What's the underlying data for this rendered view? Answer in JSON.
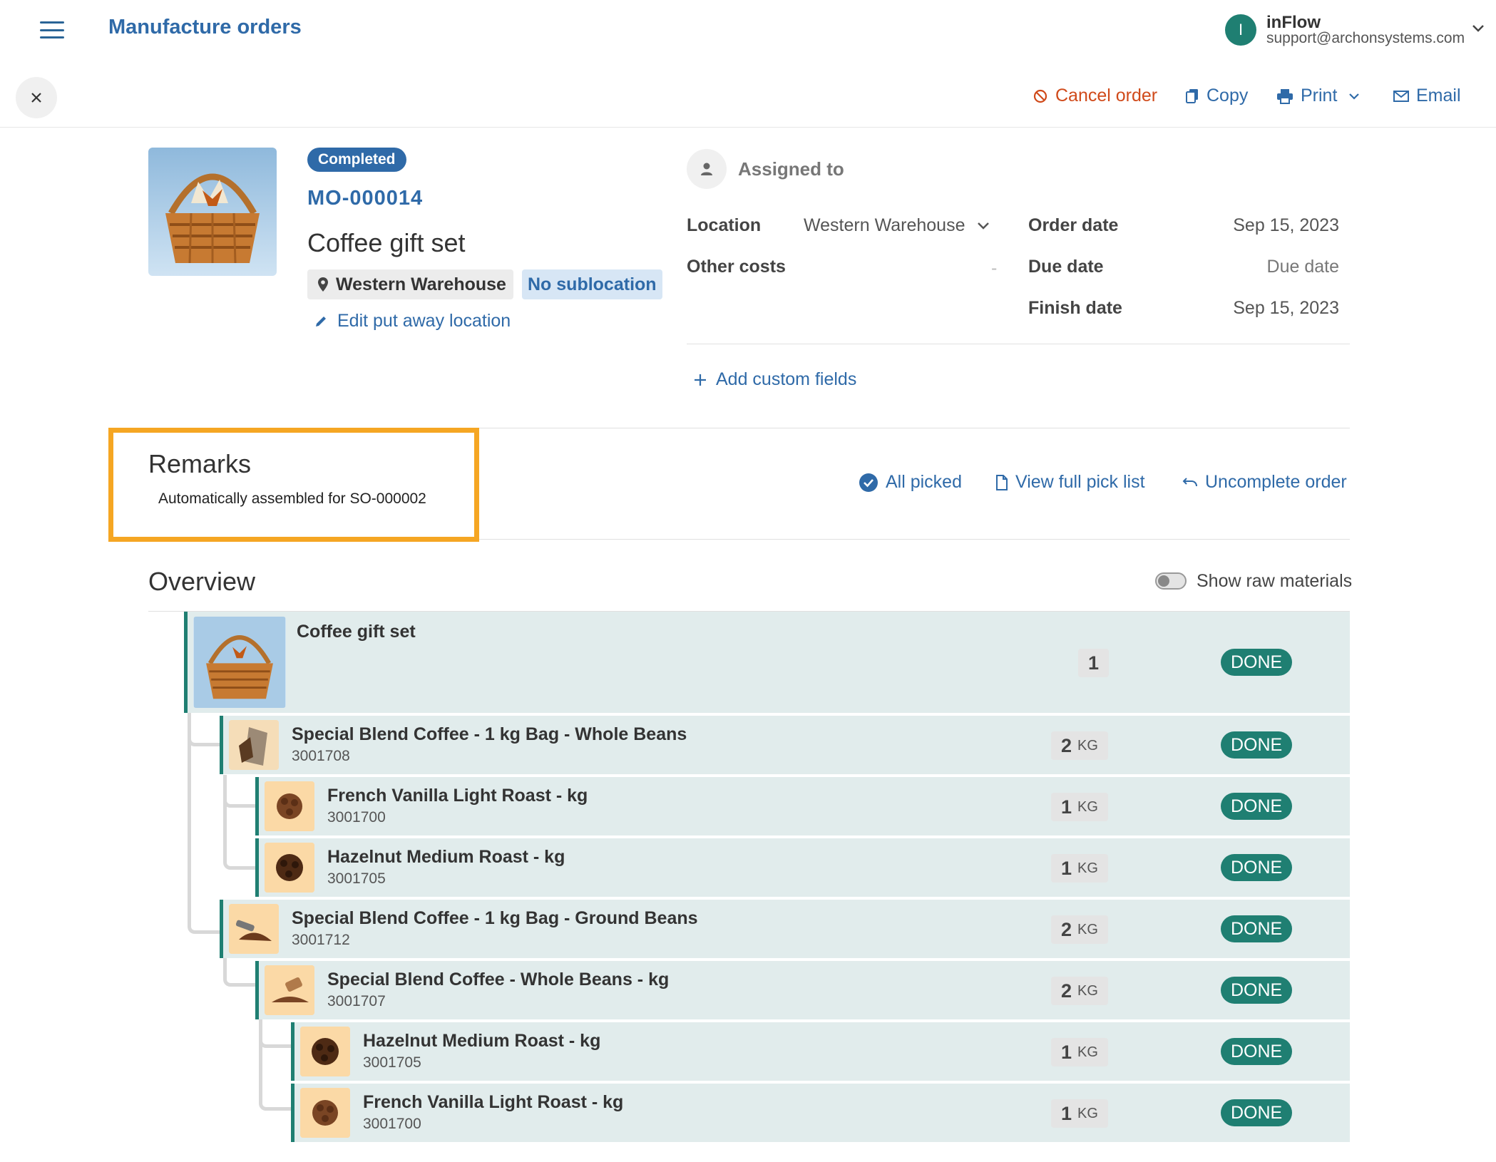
{
  "header": {
    "title": "Manufacture orders",
    "user_initial": "I",
    "user_name": "inFlow",
    "user_email": "support@archonsystems.com"
  },
  "toolbar": {
    "cancel_label": "Cancel order",
    "copy_label": "Copy",
    "print_label": "Print",
    "email_label": "Email"
  },
  "order": {
    "status": "Completed",
    "number": "MO-000014",
    "product_name": "Coffee gift set",
    "location": "Western Warehouse",
    "sublocation": "No sublocation",
    "edit_location_label": "Edit put away location"
  },
  "details": {
    "assigned_label": "Assigned to",
    "location_label": "Location",
    "location_value": "Western Warehouse",
    "other_costs_label": "Other costs",
    "other_costs_value": "-",
    "order_date_label": "Order date",
    "order_date_value": "Sep 15, 2023",
    "due_date_label": "Due date",
    "due_date_value": "Due date",
    "finish_date_label": "Finish date",
    "finish_date_value": "Sep 15, 2023",
    "add_custom_label": "Add custom fields"
  },
  "remarks": {
    "title": "Remarks",
    "text": "Automatically assembled for SO-000002"
  },
  "actions": {
    "all_picked": "All picked",
    "view_pick_list": "View full pick list",
    "uncomplete": "Uncomplete order"
  },
  "overview": {
    "title": "Overview",
    "toggle_label": "Show raw materials",
    "rows": [
      {
        "name": "Coffee gift set",
        "code": "",
        "qty": "1",
        "unit": "",
        "status": "DONE"
      },
      {
        "name": "Special Blend Coffee - 1 kg Bag - Whole Beans",
        "code": "3001708",
        "qty": "2",
        "unit": "KG",
        "status": "DONE"
      },
      {
        "name": "French Vanilla Light Roast - kg",
        "code": "3001700",
        "qty": "1",
        "unit": "KG",
        "status": "DONE"
      },
      {
        "name": "Hazelnut Medium Roast - kg",
        "code": "3001705",
        "qty": "1",
        "unit": "KG",
        "status": "DONE"
      },
      {
        "name": "Special Blend Coffee - 1 kg Bag - Ground Beans",
        "code": "3001712",
        "qty": "2",
        "unit": "KG",
        "status": "DONE"
      },
      {
        "name": "Special Blend Coffee - Whole Beans - kg",
        "code": "3001707",
        "qty": "2",
        "unit": "KG",
        "status": "DONE"
      },
      {
        "name": "Hazelnut Medium Roast - kg",
        "code": "3001705",
        "qty": "1",
        "unit": "KG",
        "status": "DONE"
      },
      {
        "name": "French Vanilla Light Roast - kg",
        "code": "3001700",
        "qty": "1",
        "unit": "KG",
        "status": "DONE"
      }
    ]
  },
  "colors": {
    "brand_blue": "#2f6aa8",
    "teal": "#1f7f72",
    "cancel_red": "#d04a1a",
    "highlight_orange": "#f5a623",
    "row_bg": "#e1ecec"
  }
}
